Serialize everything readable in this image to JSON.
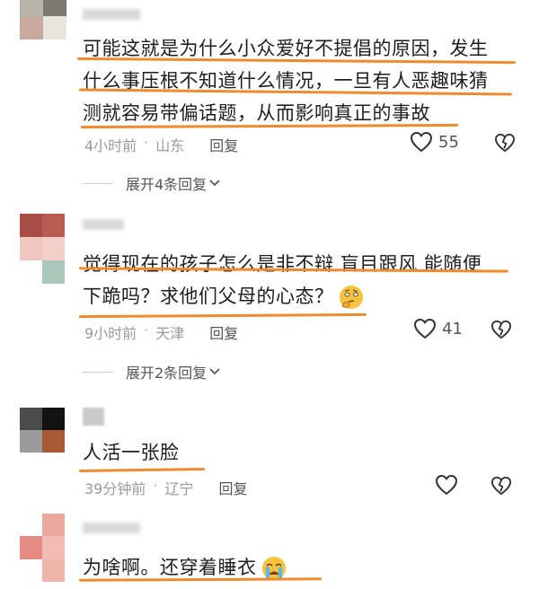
{
  "comments": [
    {
      "author": "",
      "text_lines": [
        "可能这就是为什么小众爱好不提倡的原因，发生",
        "什么事压根不知道什么情况，一旦有人恶趣味猜",
        "测就容易带偏话题，从而影响真正的事故"
      ],
      "time": "4小时前",
      "location": "山东",
      "reply_label": "回复",
      "likes": "55",
      "expand_label": "展开4条回复"
    },
    {
      "author": "",
      "text_lines": [
        "觉得现在的孩子怎么是非不辩 盲目跟风 能随便",
        "下跪吗？求他们父母的心态？"
      ],
      "emoji": "thinking-face-emoji",
      "time": "9小时前",
      "location": "天津",
      "reply_label": "回复",
      "likes": "41",
      "expand_label": "展开2条回复"
    },
    {
      "author": "",
      "text_lines": [
        "人活一张脸"
      ],
      "time": "39分钟前",
      "location": "辽宁",
      "reply_label": "回复",
      "likes": ""
    },
    {
      "author": "",
      "text_lines": [
        "为啥啊。还穿着睡衣"
      ],
      "emoji": "crying-face-emoji"
    }
  ],
  "colors": {
    "underline": "#f08a2c",
    "text": "#1e1e1e",
    "meta": "#9a9a9a"
  },
  "icons": {
    "like": "heart-outline-icon",
    "dislike": "broken-heart-outline-icon",
    "expand": "chevron-down-icon"
  }
}
